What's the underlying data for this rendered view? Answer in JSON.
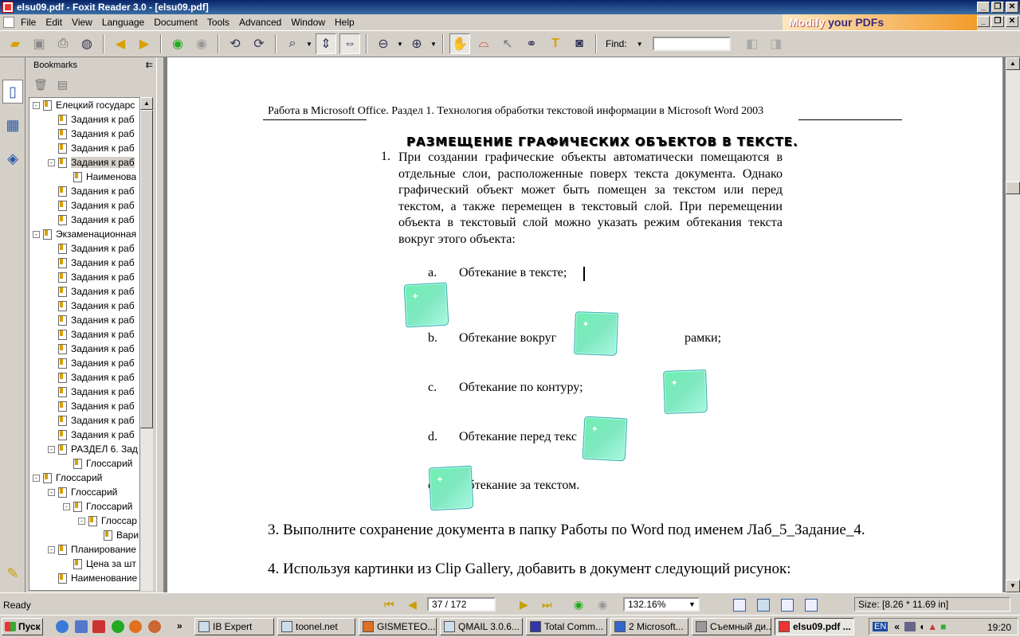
{
  "window": {
    "title": "elsu09.pdf - Foxit Reader 3.0 - [elsu09.pdf]"
  },
  "menu": [
    "File",
    "Edit",
    "View",
    "Language",
    "Document",
    "Tools",
    "Advanced",
    "Window",
    "Help"
  ],
  "ad": {
    "text1": "Modify",
    "text2": "your PDFs"
  },
  "toolbar": {
    "find_label": "Find:",
    "find_value": ""
  },
  "bookmarks": {
    "title": "Bookmarks",
    "items": [
      {
        "label": "Елецкий государс",
        "level": 0,
        "expander": "-"
      },
      {
        "label": "Задания к раб",
        "level": 1
      },
      {
        "label": "Задания к раб",
        "level": 1
      },
      {
        "label": "Задания к раб",
        "level": 1
      },
      {
        "label": "Задания к раб",
        "level": 1,
        "expander": "-",
        "selected": true
      },
      {
        "label": "Наименова",
        "level": 2
      },
      {
        "label": "Задания к раб",
        "level": 1
      },
      {
        "label": "Задания к раб",
        "level": 1
      },
      {
        "label": "Задания к раб",
        "level": 1
      },
      {
        "label": "Экзаменационная",
        "level": 0,
        "expander": "-"
      },
      {
        "label": "Задания к раб",
        "level": 1
      },
      {
        "label": "Задания к раб",
        "level": 1
      },
      {
        "label": "Задания к раб",
        "level": 1
      },
      {
        "label": "Задания к раб",
        "level": 1
      },
      {
        "label": "Задания к раб",
        "level": 1
      },
      {
        "label": "Задания к раб",
        "level": 1
      },
      {
        "label": "Задания к раб",
        "level": 1
      },
      {
        "label": "Задания к раб",
        "level": 1
      },
      {
        "label": "Задания к раб",
        "level": 1
      },
      {
        "label": "Задания к раб",
        "level": 1
      },
      {
        "label": "Задания к раб",
        "level": 1
      },
      {
        "label": "Задания к раб",
        "level": 1
      },
      {
        "label": "Задания к раб",
        "level": 1
      },
      {
        "label": "Задания к раб",
        "level": 1
      },
      {
        "label": "РАЗДЕЛ 6. Зад",
        "level": 1,
        "expander": "-"
      },
      {
        "label": "Глоссарий",
        "level": 2
      },
      {
        "label": "Глоссарий",
        "level": 0,
        "expander": "-"
      },
      {
        "label": "Глоссарий",
        "level": 1,
        "expander": "-"
      },
      {
        "label": "Глоссарий",
        "level": 2,
        "expander": "-"
      },
      {
        "label": "Глоссар",
        "level": 3,
        "expander": "-"
      },
      {
        "label": "Вари",
        "level": 4
      },
      {
        "label": "Планирование",
        "level": 1,
        "expander": "-"
      },
      {
        "label": "Цена за шт",
        "level": 2
      },
      {
        "label": "Наименование",
        "level": 1
      }
    ]
  },
  "document": {
    "header": "Работа в Microsoft Office. Раздел 1. Технология обработки текстовой информации в Microsoft Word 2003",
    "heading": "РАЗМЕЩЕНИЕ ГРАФИЧЕСКИХ ОБЪЕКТОВ В ТЕКСТЕ.",
    "item_number": "1.",
    "paragraph": "При создании графические объекты автоматически помещаются в отдельные слои, расположенные поверх текста документа. Однако графический объект может быть помещен за текстом или перед текстом, а также перемещен в текстовый слой. При перемещении объекта в текстовый слой можно указать режим обтекания текста вокруг этого объекта:",
    "list": [
      {
        "marker": "a.",
        "text": "Обтекание в тексте;"
      },
      {
        "marker": "b.",
        "text": "Обтекание вокруг",
        "tail": "рамки;"
      },
      {
        "marker": "c.",
        "text": "Обтекание по контуру;"
      },
      {
        "marker": "d.",
        "text": "Обтекание перед текс"
      },
      {
        "marker": "e.",
        "text": "Обтекание за текстом."
      }
    ],
    "para3": "3. Выполните сохранение документа в папку Работы по Word под именем Лаб_5_Задание_4.",
    "para4": "4. Используя картинки из Clip Gallery, добавить в документ следующий рисунок:"
  },
  "status": {
    "ready": "Ready",
    "page": "37 / 172",
    "zoom": "132.16%",
    "size": "Size: [8.26 * 11.69 in]"
  },
  "taskbar": {
    "start": "Пуск",
    "tasks": [
      "IB Expert",
      "toonel.net",
      "GISMETEO....",
      "QMAIL 3.0.6...",
      "Total Comm...",
      "2 Microsoft...",
      "Съемный ди...",
      "elsu09.pdf ..."
    ],
    "lang": "EN",
    "clock": "19:20"
  }
}
